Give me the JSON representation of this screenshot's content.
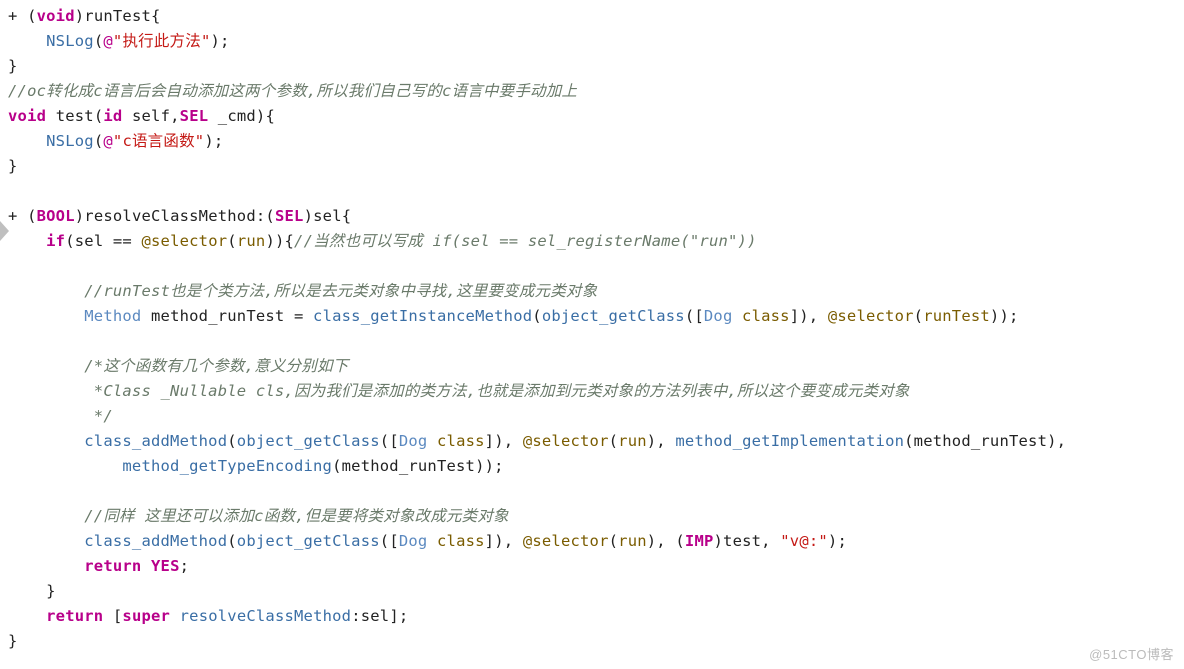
{
  "code": {
    "l1": {
      "plus": "+ (",
      "void": "void",
      "rparen": ")",
      "name": "runTest",
      "brace": "{"
    },
    "l2": {
      "ind": "    ",
      "fn": "NSLog",
      "open": "(",
      "at": "@",
      "str": "\"执行此方法\"",
      "close": ");"
    },
    "l3": "}",
    "l4": {
      "cm": "//oc转化成c语言后会自动添加这两个参数,所以我们自己写的c语言中要手动加上"
    },
    "l5": {
      "void": "void",
      "sp": " ",
      "name": "test",
      "open": "(",
      "id": "id",
      "p1": " self,",
      "sel": "SEL",
      "p2": " _cmd){"
    },
    "l6": {
      "ind": "    ",
      "fn": "NSLog",
      "open": "(",
      "at": "@",
      "str": "\"c语言函数\"",
      "close": ");"
    },
    "l7": "}",
    "l8": "",
    "l9": {
      "plus": "+ (",
      "bool": "BOOL",
      "rparen": ")",
      "name": "resolveClassMethod",
      "colon": ":",
      "lp": "(",
      "sel": "SEL",
      "rp": ")",
      "arg": "sel",
      "brace": "{"
    },
    "l10": {
      "ind": "    ",
      "if": "if",
      "open": "(sel == ",
      "at": "@selector",
      "lp": "(",
      "run": "run",
      "rp": ")){",
      "cm": "//当然也可以写成 if(sel == sel_registerName(\"run\"))"
    },
    "l11": "",
    "l12": {
      "ind": "        ",
      "cm": "//runTest也是个类方法,所以是去元类对象中寻找,这里要变成元类对象"
    },
    "l13": {
      "ind": "        ",
      "Method": "Method",
      "var": " method_runTest = ",
      "fn1": "class_getInstanceMethod",
      "lp1": "(",
      "fn2": "object_getClass",
      "lp2": "([",
      "Dog": "Dog",
      "cls": " class",
      "rb": "]), ",
      "at": "@selector",
      "lp3": "(",
      "rt": "runTest",
      "rp3": "));"
    },
    "l14": "",
    "l15": {
      "ind": "        ",
      "cm": "/*这个函数有几个参数,意义分别如下"
    },
    "l16": {
      "ind": "         ",
      "cm": "*Class _Nullable cls,因为我们是添加的类方法,也就是添加到元类对象的方法列表中,所以这个要变成元类对象"
    },
    "l17": {
      "ind": "         ",
      "cm": "*/"
    },
    "l18": {
      "ind": "        ",
      "fn1": "class_addMethod",
      "lp1": "(",
      "fn2": "object_getClass",
      "lp2": "([",
      "Dog": "Dog",
      "cls": " class",
      "rb": "]), ",
      "at": "@selector",
      "lp3": "(",
      "run": "run",
      "rp3": "), ",
      "fn3": "method_getImplementation",
      "lp4": "(method_runTest),"
    },
    "l19": {
      "ind": "            ",
      "fn": "method_getTypeEncoding",
      "arg": "(method_runTest));"
    },
    "l20": "",
    "l21": {
      "ind": "        ",
      "cm": "//同样 这里还可以添加c函数,但是要将类对象改成元类对象"
    },
    "l22": {
      "ind": "        ",
      "fn1": "class_addMethod",
      "lp1": "(",
      "fn2": "object_getClass",
      "lp2": "([",
      "Dog": "Dog",
      "cls": " class",
      "rb": "]), ",
      "at": "@selector",
      "lp3": "(",
      "run": "run",
      "rp3": "), (",
      "imp": "IMP",
      "rest": ")test, ",
      "str": "\"v@:\"",
      "end": ");"
    },
    "l23": {
      "ind": "        ",
      "ret": "return",
      "yes": " YES",
      "semi": ";"
    },
    "l24": {
      "ind": "    ",
      "brace": "}"
    },
    "l25": {
      "ind": "    ",
      "ret": "return",
      "sp": " [",
      "super": "super",
      "call": " resolveClassMethod",
      "colon": ":sel];"
    },
    "l26": "}"
  },
  "watermark": "@51CTO博客"
}
